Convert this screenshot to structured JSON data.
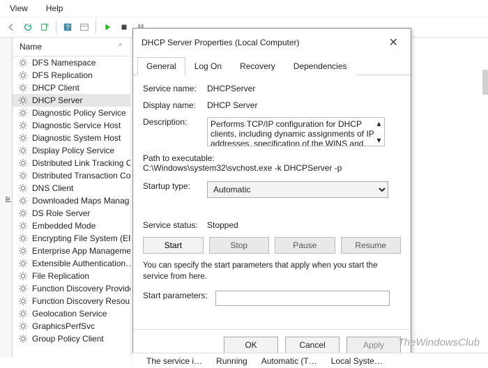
{
  "menu": {
    "view": "View",
    "help": "Help"
  },
  "leftpanel_label": "al",
  "column_header": "Name",
  "services": [
    "DFS Namespace",
    "DFS Replication",
    "DHCP Client",
    "DHCP Server",
    "Diagnostic Policy Service",
    "Diagnostic Service Host",
    "Diagnostic System Host",
    "Display Policy Service",
    "Distributed Link Tracking Cl…",
    "Distributed Transaction Co…",
    "DNS Client",
    "Downloaded Maps Manag…",
    "DS Role Server",
    "Embedded Mode",
    "Encrypting File System (EF…",
    "Enterprise App Manageme…",
    "Extensible Authentication…",
    "File Replication",
    "Function Discovery Provide…",
    "Function Discovery Resou…",
    "Geolocation Service",
    "GraphicsPerfSvc",
    "Group Policy Client"
  ],
  "selected_service_index": 3,
  "dialog": {
    "title": "DHCP Server Properties (Local Computer)",
    "tabs": [
      "General",
      "Log On",
      "Recovery",
      "Dependencies"
    ],
    "active_tab": 0,
    "labels": {
      "service_name": "Service name:",
      "display_name": "Display name:",
      "description": "Description:",
      "path": "Path to executable:",
      "startup": "Startup type:",
      "status": "Service status:",
      "params": "Start parameters:"
    },
    "service_name": "DHCPServer",
    "display_name": "DHCP Server",
    "description": "Performs TCP/IP configuration for DHCP clients, including dynamic assignments of IP addresses, specification of the WINS and DNS servers, and",
    "path": "C:\\Windows\\system32\\svchost.exe -k DHCPServer -p",
    "startup_options": [
      "Automatic"
    ],
    "startup_selected": "Automatic",
    "status": "Stopped",
    "buttons": {
      "start": "Start",
      "stop": "Stop",
      "pause": "Pause",
      "resume": "Resume"
    },
    "note": "You can specify the start parameters that apply when you start the service from here.",
    "params_value": "",
    "footer": {
      "ok": "OK",
      "cancel": "Cancel",
      "apply": "Apply"
    }
  },
  "statusbar": [
    "The service i…",
    "Running",
    "Automatic (T…",
    "Local Syste…"
  ],
  "watermark": "TheWindowsClub"
}
